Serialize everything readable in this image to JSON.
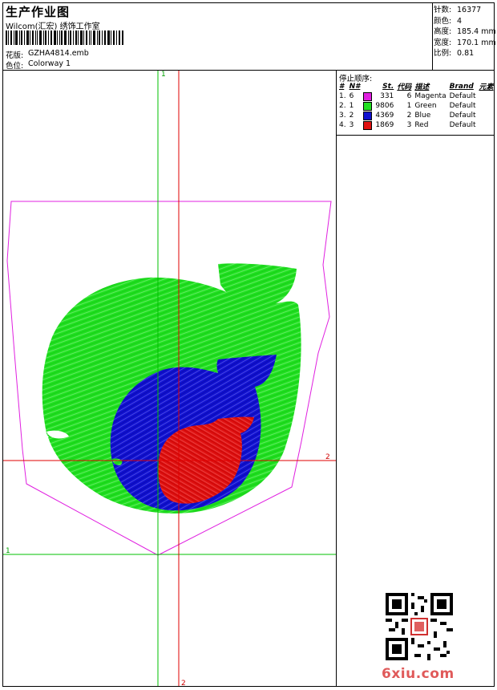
{
  "header": {
    "title": "生产作业图",
    "subtitle": "Wilcom(汇宏) 绣饰工作室",
    "pattern_label": "花版:",
    "pattern_value": "GZHA4814.emb",
    "colorway_label": "色位:",
    "colorway_value": "Colorway 1"
  },
  "stats": {
    "stitches_label": "针数:",
    "stitches_value": "16377",
    "colors_label": "颜色:",
    "colors_value": "4",
    "height_label": "高度:",
    "height_value": "185.4 mm",
    "width_label": "宽度:",
    "width_value": "170.1 mm",
    "scale_label": "比例:",
    "scale_value": "0.81"
  },
  "stop_sequence": {
    "title": "停止顺序:",
    "headers": [
      "#",
      "N#",
      "St.",
      "代码",
      "描述",
      "Brand",
      "元素"
    ],
    "rows": [
      {
        "index": "1.",
        "needle": "6",
        "color": "#e020e0",
        "stitches": "331",
        "code": "6",
        "desc": "Magenta",
        "brand": "Default"
      },
      {
        "index": "2.",
        "needle": "1",
        "color": "#20e020",
        "stitches": "9806",
        "code": "1",
        "desc": "Green",
        "brand": "Default"
      },
      {
        "index": "3.",
        "needle": "2",
        "color": "#1010d0",
        "stitches": "4369",
        "code": "2",
        "desc": "Blue",
        "brand": "Default"
      },
      {
        "index": "4.",
        "needle": "3",
        "color": "#e01010",
        "stitches": "1869",
        "code": "3",
        "desc": "Red",
        "brand": "Default"
      }
    ]
  },
  "guides": {
    "v_top_label": "1",
    "h_right_label": "2",
    "h_left_label": "1",
    "v_bottom_label": "2"
  },
  "colors": {
    "magenta": "#e020e0",
    "green": "#20e020",
    "blue": "#1010d0",
    "red": "#e01010",
    "guide_green": "#00c000",
    "guide_red": "#e00000"
  },
  "watermark": "6xiu.com"
}
